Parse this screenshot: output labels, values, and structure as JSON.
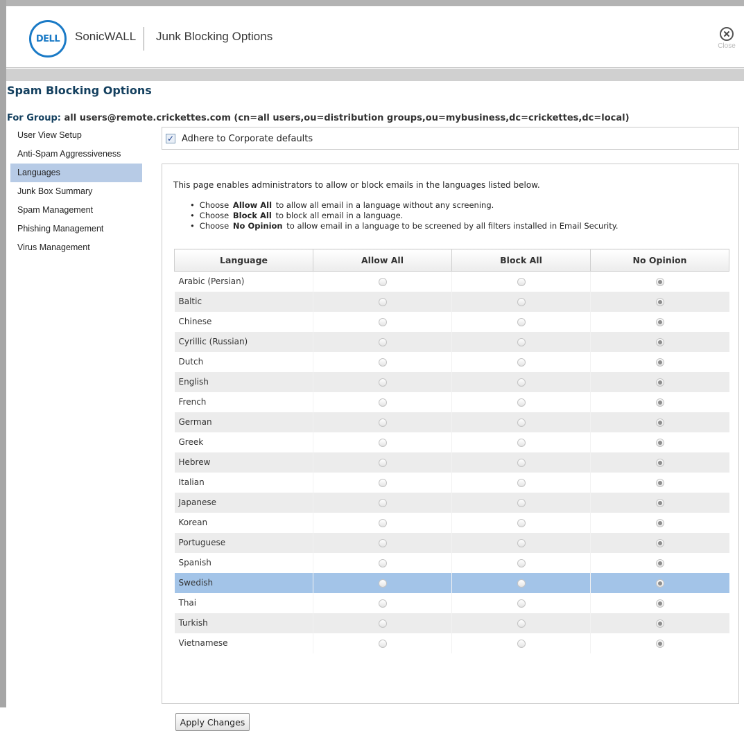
{
  "header": {
    "logo_text": "DELL",
    "brand": "SonicWALL",
    "title": "Junk Blocking Options",
    "close_label": "Close"
  },
  "page": {
    "title": "Spam Blocking Options",
    "group_label": "For Group:",
    "group_value": "all users@remote.crickettes.com (cn=all users,ou=distribution groups,ou=mybusiness,dc=crickettes,dc=local)"
  },
  "sidebar": {
    "items": [
      {
        "label": "User View Setup",
        "active": false
      },
      {
        "label": "Anti-Spam Aggressiveness",
        "active": false
      },
      {
        "label": "Languages",
        "active": true
      },
      {
        "label": "Junk Box Summary",
        "active": false
      },
      {
        "label": "Spam Management",
        "active": false
      },
      {
        "label": "Phishing Management",
        "active": false
      },
      {
        "label": "Virus Management",
        "active": false
      }
    ]
  },
  "corporate": {
    "checked": true,
    "label": "Adhere to Corporate defaults"
  },
  "intro": {
    "text": "This page enables administrators to allow or block emails in the languages listed below.",
    "bullets": [
      {
        "prefix": "Choose",
        "strong": "Allow All",
        "rest": "to allow all email in a language without any screening."
      },
      {
        "prefix": "Choose",
        "strong": "Block All",
        "rest": "to block all email in a language."
      },
      {
        "prefix": "Choose",
        "strong": "No Opinion",
        "rest": "to allow email in a language to be screened by all filters installed in Email Security."
      }
    ]
  },
  "table": {
    "columns": [
      "Language",
      "Allow All",
      "Block All",
      "No Opinion"
    ],
    "rows": [
      {
        "language": "Arabic (Persian)",
        "selected": "No Opinion"
      },
      {
        "language": "Baltic",
        "selected": "No Opinion"
      },
      {
        "language": "Chinese",
        "selected": "No Opinion"
      },
      {
        "language": "Cyrillic (Russian)",
        "selected": "No Opinion"
      },
      {
        "language": "Dutch",
        "selected": "No Opinion"
      },
      {
        "language": "English",
        "selected": "No Opinion"
      },
      {
        "language": "French",
        "selected": "No Opinion"
      },
      {
        "language": "German",
        "selected": "No Opinion"
      },
      {
        "language": "Greek",
        "selected": "No Opinion"
      },
      {
        "language": "Hebrew",
        "selected": "No Opinion"
      },
      {
        "language": "Italian",
        "selected": "No Opinion"
      },
      {
        "language": "Japanese",
        "selected": "No Opinion"
      },
      {
        "language": "Korean",
        "selected": "No Opinion"
      },
      {
        "language": "Portuguese",
        "selected": "No Opinion"
      },
      {
        "language": "Spanish",
        "selected": "No Opinion"
      },
      {
        "language": "Swedish",
        "selected": "No Opinion",
        "highlighted": true
      },
      {
        "language": "Thai",
        "selected": "No Opinion"
      },
      {
        "language": "Turkish",
        "selected": "No Opinion"
      },
      {
        "language": "Vietnamese",
        "selected": "No Opinion"
      }
    ]
  },
  "actions": {
    "apply_label": "Apply Changes"
  },
  "colors": {
    "accent": "#1a7ac6",
    "title": "#14405f",
    "nav_active": "#b7cbe6",
    "row_highlight": "#a3c4e8",
    "row_alt": "#ececec"
  },
  "icons": {
    "logo": "dell-logo-icon",
    "close": "close-circle-icon",
    "checkbox": "checkmark-icon",
    "radio": "radio-icon"
  }
}
